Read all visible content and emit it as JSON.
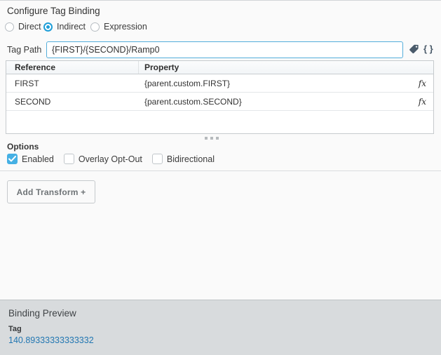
{
  "accent_color": "#1e9ed8",
  "header": {
    "title": "Configure Tag Binding"
  },
  "binding_type": {
    "options": [
      {
        "label": "Direct",
        "selected": false
      },
      {
        "label": "Indirect",
        "selected": true
      },
      {
        "label": "Expression",
        "selected": false
      }
    ]
  },
  "tag_path": {
    "label": "Tag Path",
    "value": "{FIRST}/{SECOND}/Ramp0",
    "icons": [
      {
        "name": "tag-icon"
      },
      {
        "name": "braces-icon",
        "glyph": "{ }"
      }
    ]
  },
  "references_table": {
    "columns": [
      "Reference",
      "Property"
    ],
    "rows": [
      {
        "reference": "FIRST",
        "property": "{parent.custom.FIRST}",
        "fx": "fx"
      },
      {
        "reference": "SECOND",
        "property": "{parent.custom.SECOND}",
        "fx": "fx"
      }
    ]
  },
  "options": {
    "label": "Options",
    "checkboxes": [
      {
        "label": "Enabled",
        "checked": true
      },
      {
        "label": "Overlay Opt-Out",
        "checked": false
      },
      {
        "label": "Bidirectional",
        "checked": false
      }
    ]
  },
  "toolbar": {
    "add_transform_label": "Add Transform +"
  },
  "binding_preview": {
    "title": "Binding Preview",
    "field_label": "Tag",
    "value": "140.89333333333332"
  }
}
